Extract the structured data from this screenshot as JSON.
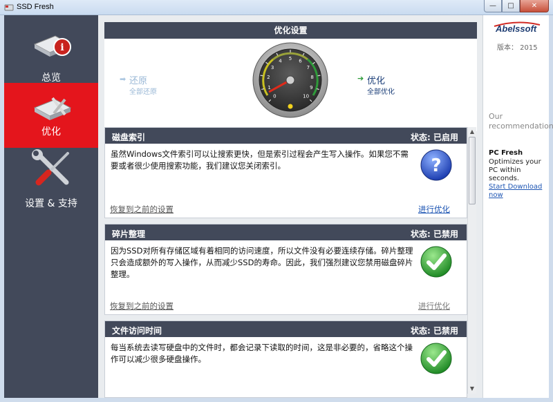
{
  "window": {
    "title": "SSD Fresh"
  },
  "sidebar": {
    "items": [
      {
        "label": "总览",
        "icon": "drive-info-icon",
        "active": false
      },
      {
        "label": "优化",
        "icon": "drive-tools-icon",
        "active": true
      },
      {
        "label": "设置 & 支持",
        "icon": "wrench-screwdriver-icon",
        "active": false
      }
    ]
  },
  "optimization": {
    "header": "优化设置",
    "restore": {
      "label": "还原",
      "sub": "全部还原"
    },
    "optimize": {
      "label": "优化",
      "sub": "全部优化"
    },
    "gauge": {
      "ticks": [
        "0",
        "1",
        "2",
        "3",
        "4",
        "5",
        "6",
        "7",
        "8",
        "9",
        "10"
      ],
      "value": 0.6
    }
  },
  "cards": [
    {
      "title": "磁盘索引",
      "status": "状态: 已启用",
      "text": "虽然Windows文件索引可以让搜索更快，但是索引过程会产生写入操作。如果您不需要或者很少使用搜索功能，我们建议您关闭索引。",
      "restore": "恢复到之前的设置",
      "optimize": "进行优化",
      "badge": "question-icon"
    },
    {
      "title": "碎片整理",
      "status": "状态: 已禁用",
      "text": "因为SSD对所有存储区域有着相同的访问速度，所以文件没有必要连续存储。碎片整理只会造成额外的写入操作，从而减少SSD的寿命。因此，我们强烈建议您禁用磁盘碎片整理。",
      "restore": "恢复到之前的设置",
      "optimize": "进行优化",
      "badge": "check-icon"
    },
    {
      "title": "文件访问时间",
      "status": "状态: 已禁用",
      "text": "每当系统去读写硬盘中的文件时，都会记录下读取的时间，这是非必要的，省略这个操作可以减少很多硬盘操作。",
      "badge": "check-icon"
    }
  ],
  "ad": {
    "brand": "Abelssoft",
    "version": "版本： 2015",
    "recommendation": "Our recommendation:",
    "product": "PC Fresh",
    "description": "Optimizes your PC within seconds.",
    "link": "Start Download now"
  },
  "colors": {
    "accent_red": "#e4151c",
    "dark_header": "#42495a",
    "link_blue": "#1d55b3",
    "check_green": "#3aa53a",
    "question_blue": "#2b55c6"
  }
}
